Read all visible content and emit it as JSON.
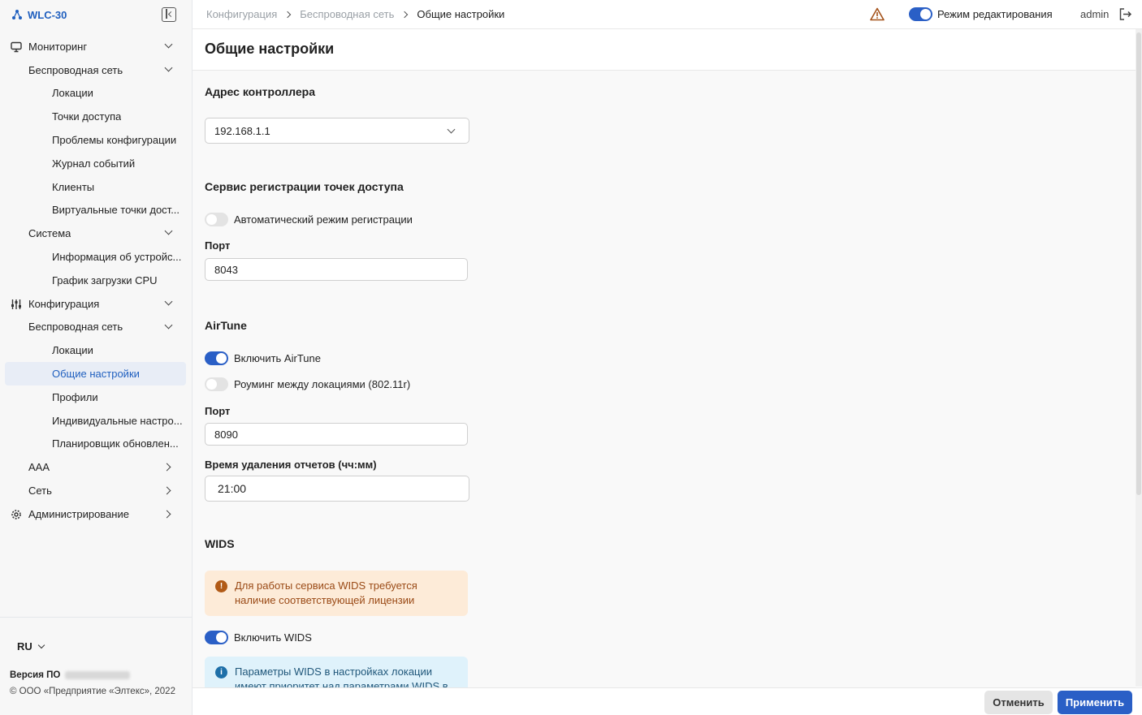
{
  "app": {
    "title": "WLC-30"
  },
  "topbar": {
    "breadcrumbs": [
      "Конфигурация",
      "Беспроводная сеть",
      "Общие настройки"
    ],
    "edit_mode_label": "Режим редактирования",
    "user": "admin"
  },
  "sidebar": {
    "items": [
      {
        "label": "Мониторинг",
        "level": 0,
        "icon": "monitor-icon",
        "chevron": "down"
      },
      {
        "label": "Беспроводная сеть",
        "level": 1,
        "chevron": "down"
      },
      {
        "label": "Локации",
        "level": 2
      },
      {
        "label": "Точки доступа",
        "level": 2
      },
      {
        "label": "Проблемы конфигурации",
        "level": 2
      },
      {
        "label": "Журнал событий",
        "level": 2
      },
      {
        "label": "Клиенты",
        "level": 2
      },
      {
        "label": "Виртуальные точки дост...",
        "level": 2
      },
      {
        "label": "Система",
        "level": 1,
        "chevron": "down"
      },
      {
        "label": "Информация об устройс...",
        "level": 2
      },
      {
        "label": "График загрузки CPU",
        "level": 2
      },
      {
        "label": "Конфигурация",
        "level": 0,
        "icon": "sliders-icon",
        "chevron": "down"
      },
      {
        "label": "Беспроводная сеть",
        "level": 1,
        "chevron": "down"
      },
      {
        "label": "Локации",
        "level": 2
      },
      {
        "label": "Общие настройки",
        "level": 2,
        "active": true
      },
      {
        "label": "Профили",
        "level": 2
      },
      {
        "label": "Индивидуальные настро...",
        "level": 2
      },
      {
        "label": "Планировщик обновлен...",
        "level": 2
      },
      {
        "label": "AAA",
        "level": 1,
        "chevron": "right"
      },
      {
        "label": "Сеть",
        "level": 1,
        "chevron": "right"
      },
      {
        "label": "Администрирование",
        "level": 0,
        "icon": "gear-icon",
        "chevron": "right"
      }
    ],
    "language": "RU",
    "version_label": "Версия ПО",
    "copyright": "© ООО «Предприятие «Элтекс», 2022"
  },
  "page": {
    "title": "Общие настройки",
    "controller": {
      "title": "Адрес контроллера",
      "address": "192.168.1.1"
    },
    "registration": {
      "title": "Сервис регистрации точек доступа",
      "auto_label": "Автоматический режим регистрации",
      "auto_enabled": false,
      "port_label": "Порт",
      "port": "8043"
    },
    "airtune": {
      "title": "AirTune",
      "enable_label": "Включить AirTune",
      "enabled": true,
      "roaming_label": "Роуминг между локациями (802.11r)",
      "roaming_enabled": false,
      "port_label": "Порт",
      "port": "8090",
      "delete_time_label": "Время удаления отчетов (чч:мм)",
      "delete_time": "21:00"
    },
    "wids": {
      "title": "WIDS",
      "license_warning": "Для работы сервиса WIDS требуется наличие соответствующей лицензии",
      "enable_label": "Включить WIDS",
      "enabled": true,
      "info_text": "Параметры WIDS в настройках локации имеют приоритет над параметрами WIDS в"
    }
  },
  "footer": {
    "cancel_label": "Отменить",
    "apply_label": "Применить"
  },
  "colors": {
    "accent": "#2a5fc6",
    "warning_bg": "#fdebd8",
    "info_bg": "#dff2fb"
  }
}
